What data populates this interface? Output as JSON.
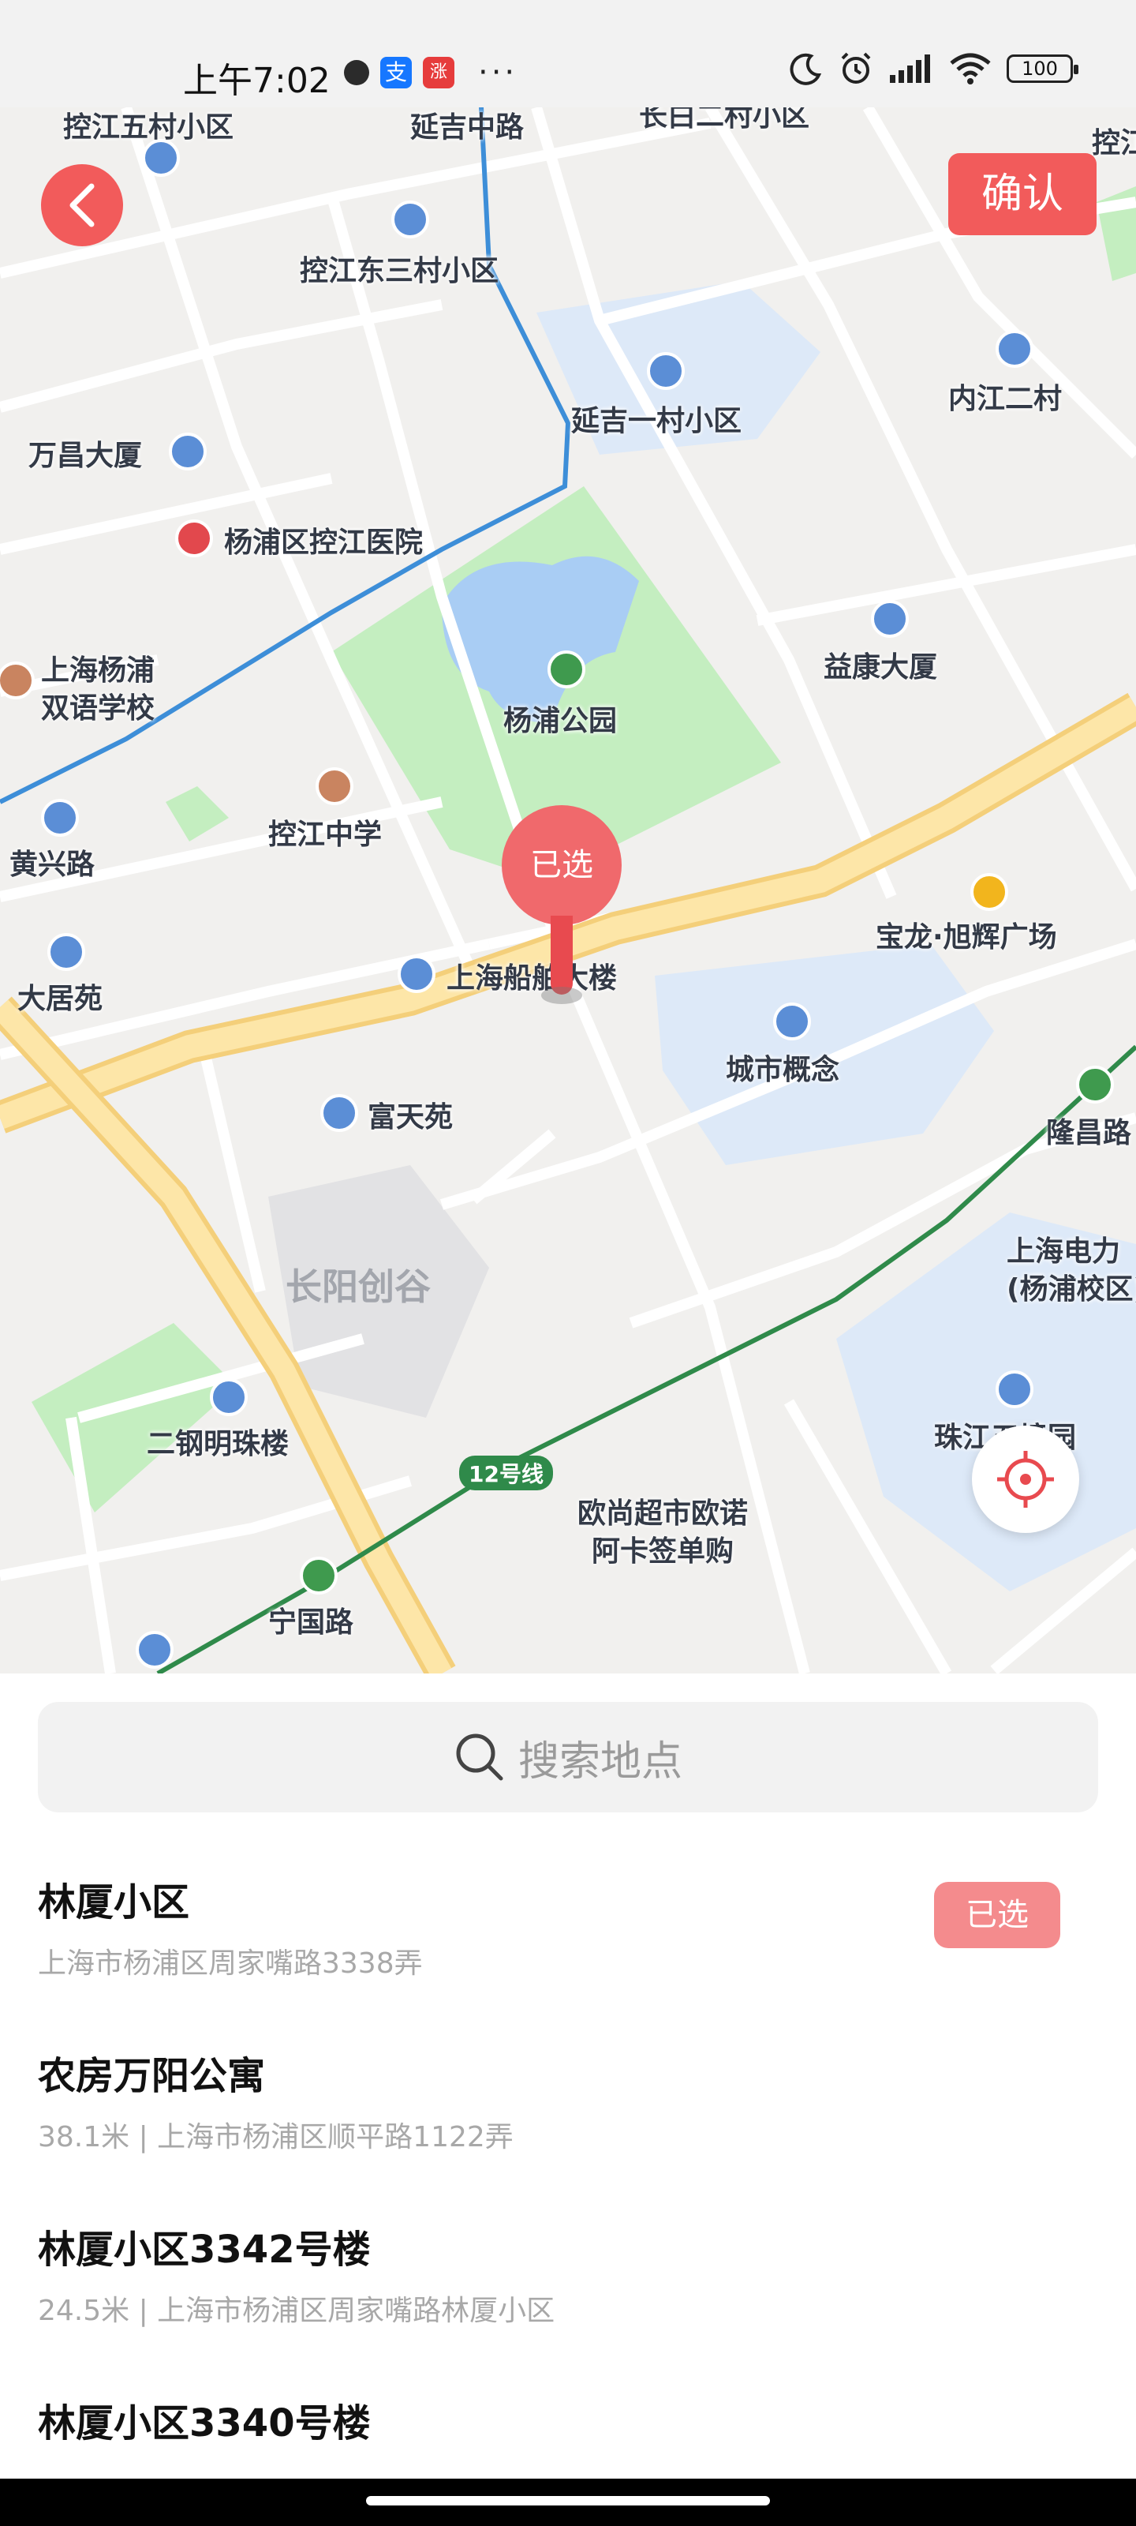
{
  "status_bar": {
    "time": "上午7:02",
    "alipay_icon": "支",
    "red_app_icon": "涨",
    "more": "···",
    "battery": "100"
  },
  "header": {
    "back_icon": "chevron-left-icon",
    "confirm_label": "确认"
  },
  "map": {
    "labels": {
      "l1": "控江五村小区",
      "l2": "延吉中路",
      "l3": "长白二村小区",
      "l4": "控江",
      "l5": "控江东三村小区",
      "l6": "延吉一村小区",
      "l7": "内江二村",
      "l8": "万昌大厦",
      "l9": "杨浦区控江医院",
      "l10": "上海杨浦\n双语学校",
      "l11": "杨浦公园",
      "l12": "益康大厦",
      "l13": "黄兴路",
      "l14": "控江中学",
      "l15": "宝龙·旭辉广场",
      "l16": "大居苑",
      "l17": "上海船舶大楼",
      "l18": "城市概念",
      "l19": "隆昌路",
      "l20": "富天苑",
      "l21": "长阳创谷",
      "l22": "上海电力\n(杨浦校区)",
      "l23": "二钢明珠楼",
      "l24": "珠江五境园",
      "l25": "12号线",
      "l26": "欧尚超市欧诺\n阿卡签单购",
      "l27": "宁国路"
    },
    "marker_label": "已选",
    "locate_icon": "crosshair-icon",
    "colors": {
      "park": "#c4eec0",
      "water": "#a9cdf4",
      "residential": "#dde9f8",
      "metro_line_blue": "#3d8ed8",
      "metro_line_green": "#2f8a4a",
      "expressway": "#fde6a8",
      "accent": "#f25b5b"
    }
  },
  "search": {
    "icon": "search-icon",
    "placeholder": "搜索地点"
  },
  "results": [
    {
      "title": "林厦小区",
      "subtitle": "上海市杨浦区周家嘴路3338弄",
      "badge": "已选"
    },
    {
      "title": "农房万阳公寓",
      "subtitle": "38.1米 | 上海市杨浦区顺平路1122弄"
    },
    {
      "title": "林厦小区3342号楼",
      "subtitle": "24.5米 | 上海市杨浦区周家嘴路林厦小区"
    },
    {
      "title": "林厦小区3340号楼",
      "subtitle": ""
    }
  ]
}
